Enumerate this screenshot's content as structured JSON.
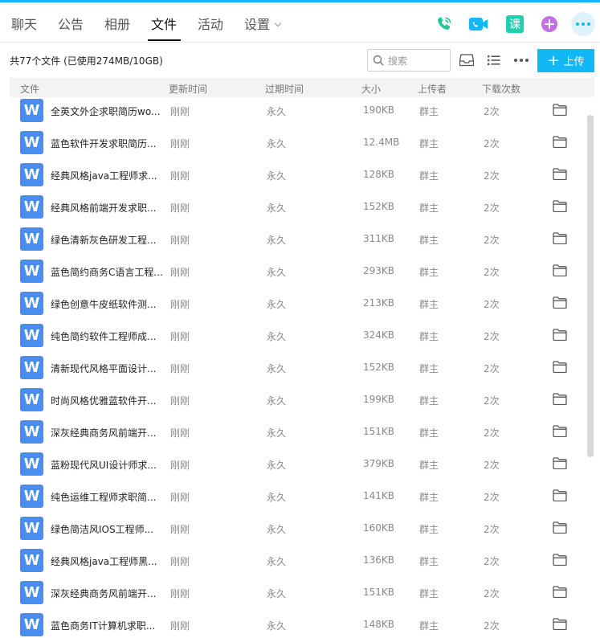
{
  "colors": {
    "accent": "#12b7f5",
    "file_icon": "#4a8df0"
  },
  "tabs": [
    {
      "label": "聊天",
      "active": false
    },
    {
      "label": "公告",
      "active": false
    },
    {
      "label": "相册",
      "active": false
    },
    {
      "label": "文件",
      "active": true
    },
    {
      "label": "活动",
      "active": false
    },
    {
      "label": "设置",
      "active": false,
      "dropdown": true
    }
  ],
  "toolbar_icons": [
    "phone-call-icon",
    "video-call-icon",
    "course-icon",
    "add-app-icon",
    "more-icon"
  ],
  "course_glyph": "课",
  "summary": "共77个文件 (已使用274MB/10GB)",
  "search": {
    "placeholder": "搜索"
  },
  "upload_label": "上传",
  "columns": {
    "name": "文件",
    "updated": "更新时间",
    "expires": "过期时间",
    "size": "大小",
    "uploader": "上传者",
    "downloads": "下载次数"
  },
  "file_icon_glyph": "W",
  "files": [
    {
      "name": "全英文外企求职简历wo...",
      "updated": "刚刚",
      "expires": "永久",
      "size": "190KB",
      "uploader": "群主",
      "downloads": "2次"
    },
    {
      "name": "蓝色软件开发求职简历...",
      "updated": "刚刚",
      "expires": "永久",
      "size": "12.4MB",
      "uploader": "群主",
      "downloads": "2次"
    },
    {
      "name": "经典风格java工程师求...",
      "updated": "刚刚",
      "expires": "永久",
      "size": "128KB",
      "uploader": "群主",
      "downloads": "2次"
    },
    {
      "name": "经典风格前端开发求职...",
      "updated": "刚刚",
      "expires": "永久",
      "size": "152KB",
      "uploader": "群主",
      "downloads": "2次"
    },
    {
      "name": "绿色清新灰色研发工程...",
      "updated": "刚刚",
      "expires": "永久",
      "size": "311KB",
      "uploader": "群主",
      "downloads": "2次"
    },
    {
      "name": "蓝色简约商务C语言工程...",
      "updated": "刚刚",
      "expires": "永久",
      "size": "293KB",
      "uploader": "群主",
      "downloads": "2次"
    },
    {
      "name": "绿色创意牛皮纸软件测...",
      "updated": "刚刚",
      "expires": "永久",
      "size": "213KB",
      "uploader": "群主",
      "downloads": "2次"
    },
    {
      "name": "纯色简约软件工程师成...",
      "updated": "刚刚",
      "expires": "永久",
      "size": "324KB",
      "uploader": "群主",
      "downloads": "2次"
    },
    {
      "name": "清新现代风格平面设计...",
      "updated": "刚刚",
      "expires": "永久",
      "size": "152KB",
      "uploader": "群主",
      "downloads": "2次"
    },
    {
      "name": "时尚风格优雅蓝软件开...",
      "updated": "刚刚",
      "expires": "永久",
      "size": "199KB",
      "uploader": "群主",
      "downloads": "2次"
    },
    {
      "name": "深灰经典商务风前端开...",
      "updated": "刚刚",
      "expires": "永久",
      "size": "151KB",
      "uploader": "群主",
      "downloads": "2次"
    },
    {
      "name": "蓝粉现代风UI设计师求...",
      "updated": "刚刚",
      "expires": "永久",
      "size": "379KB",
      "uploader": "群主",
      "downloads": "2次"
    },
    {
      "name": "纯色运维工程师求职简...",
      "updated": "刚刚",
      "expires": "永久",
      "size": "141KB",
      "uploader": "群主",
      "downloads": "2次"
    },
    {
      "name": "绿色简洁风IOS工程师...",
      "updated": "刚刚",
      "expires": "永久",
      "size": "160KB",
      "uploader": "群主",
      "downloads": "2次"
    },
    {
      "name": "经典风格java工程师黑...",
      "updated": "刚刚",
      "expires": "永久",
      "size": "136KB",
      "uploader": "群主",
      "downloads": "2次"
    },
    {
      "name": "深灰经典商务风前端开...",
      "updated": "刚刚",
      "expires": "永久",
      "size": "151KB",
      "uploader": "群主",
      "downloads": "2次"
    },
    {
      "name": "蓝色商务IT计算机求职...",
      "updated": "刚刚",
      "expires": "永久",
      "size": "148KB",
      "uploader": "群主",
      "downloads": "2次"
    }
  ]
}
